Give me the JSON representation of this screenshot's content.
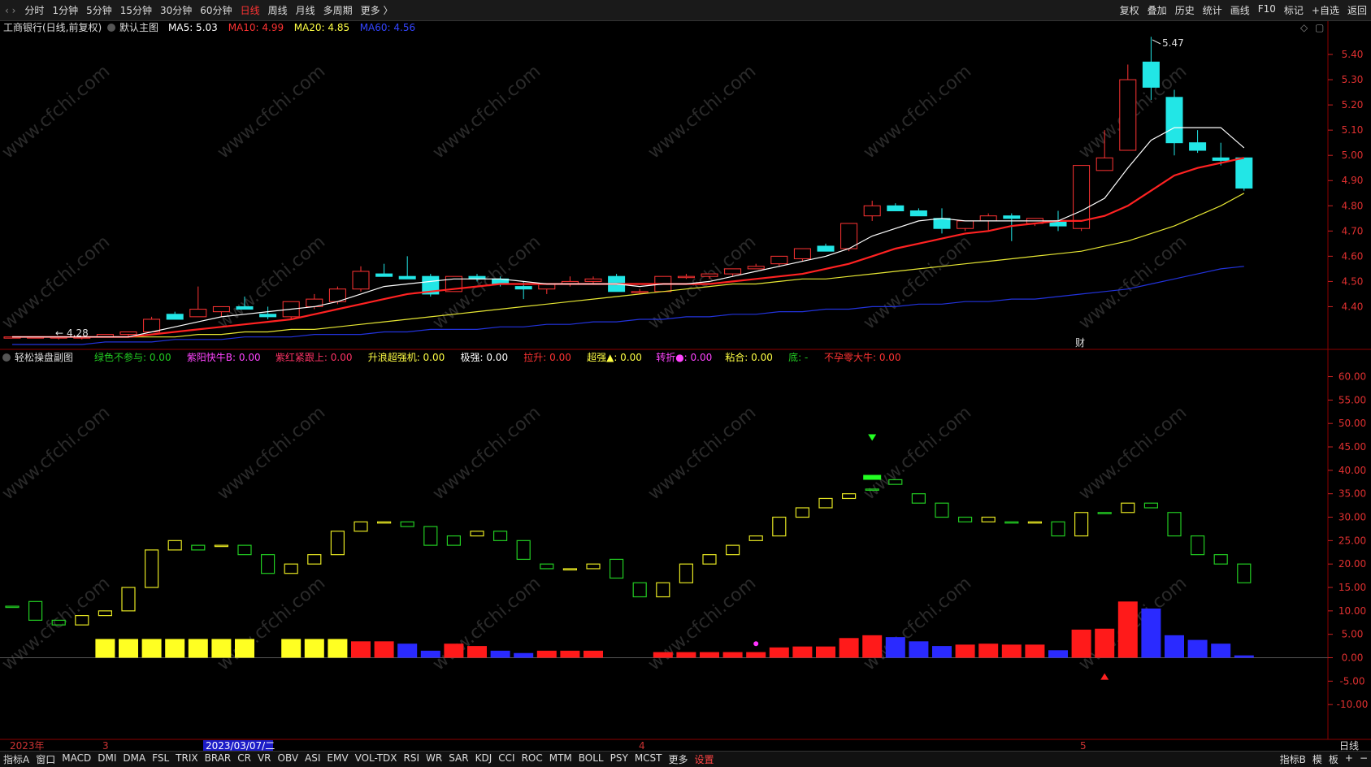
{
  "toolbar": {
    "periods": [
      "分时",
      "1分钟",
      "5分钟",
      "15分钟",
      "30分钟",
      "60分钟",
      "日线",
      "周线",
      "月线",
      "多周期",
      "更多 〉"
    ],
    "active_period": "日线",
    "right_tools": [
      "复权",
      "叠加",
      "历史",
      "统计",
      "画线",
      "F10",
      "标记",
      "+自选",
      "返回"
    ]
  },
  "main_panel": {
    "title": "工商银行(日线,前复权)",
    "chart_name": "默认主图",
    "ma_labels": [
      {
        "text": "MA5: 5.03",
        "color": "#ffffff"
      },
      {
        "text": "MA10: 4.99",
        "color": "#ff3333"
      },
      {
        "text": "MA20: 4.85",
        "color": "#ffff44"
      },
      {
        "text": "MA60: 4.56",
        "color": "#3344ff"
      }
    ],
    "price_ticks": [
      "5.40",
      "5.30",
      "5.20",
      "5.10",
      "5.00",
      "4.90",
      "4.80",
      "4.70",
      "4.60",
      "4.50",
      "4.40"
    ],
    "high_label": "5.47",
    "low_label": "4.28",
    "finance_marker": "财"
  },
  "sub_panel": {
    "title": "轻松操盘副图",
    "signals": [
      {
        "text": "绿色不参与: 0.00",
        "color": "#22cc22"
      },
      {
        "text": "紫阳快牛B: 0.00",
        "color": "#ff44ff"
      },
      {
        "text": "紫红紧跟上: 0.00",
        "color": "#ff3366"
      },
      {
        "text": "升浪超强机: 0.00",
        "color": "#ffff44"
      },
      {
        "text": "极强: 0.00",
        "color": "#ffffff"
      },
      {
        "text": "拉升: 0.00",
        "color": "#ff3333"
      },
      {
        "text": "超强▲: 0.00",
        "color": "#ffff44"
      },
      {
        "text": "转折●: 0.00",
        "color": "#ff44ff"
      },
      {
        "text": "粘合: 0.00",
        "color": "#ffff44"
      },
      {
        "text": "底: -",
        "color": "#22cc22"
      },
      {
        "text": "不孕零大牛: 0.00",
        "color": "#ff3333"
      }
    ],
    "value_ticks": [
      "60.00",
      "55.00",
      "50.00",
      "45.00",
      "40.00",
      "35.00",
      "30.00",
      "25.00",
      "20.00",
      "15.00",
      "10.00",
      "5.00",
      "0.00",
      "-5.00",
      "-10.00"
    ]
  },
  "date_axis": {
    "labels": [
      "2023年",
      "3",
      "2023/03/07/二",
      "4",
      "5"
    ],
    "period_label": "日线"
  },
  "bottom_tabs": {
    "left": [
      "指标A",
      "窗口",
      "MACD",
      "DMI",
      "DMA",
      "FSL",
      "TRIX",
      "BRAR",
      "CR",
      "VR",
      "OBV",
      "ASI",
      "EMV",
      "VOL-TDX",
      "RSI",
      "WR",
      "SAR",
      "KDJ",
      "CCI",
      "ROC",
      "MTM",
      "BOLL",
      "PSY",
      "MCST",
      "更多",
      "设置"
    ],
    "right": [
      "指标B",
      "模",
      "板",
      "+",
      "−"
    ]
  },
  "watermark": "www.cfchi.com",
  "chart_data": {
    "type": "candlestick",
    "price_range": [
      4.25,
      5.5
    ],
    "candles": [
      [
        4.28,
        4.28,
        4.28,
        4.28
      ],
      [
        4.28,
        4.28,
        4.28,
        4.28
      ],
      [
        4.28,
        4.28,
        4.27,
        4.28
      ],
      [
        4.28,
        4.28,
        4.27,
        4.28
      ],
      [
        4.28,
        4.29,
        4.28,
        4.29
      ],
      [
        4.29,
        4.3,
        4.28,
        4.3
      ],
      [
        4.3,
        4.36,
        4.3,
        4.35
      ],
      [
        4.37,
        4.38,
        4.35,
        4.35
      ],
      [
        4.36,
        4.48,
        4.36,
        4.39
      ],
      [
        4.38,
        4.4,
        4.36,
        4.4
      ],
      [
        4.4,
        4.44,
        4.39,
        4.39
      ],
      [
        4.37,
        4.4,
        4.35,
        4.36
      ],
      [
        4.36,
        4.42,
        4.35,
        4.42
      ],
      [
        4.4,
        4.45,
        4.39,
        4.43
      ],
      [
        4.42,
        4.48,
        4.41,
        4.47
      ],
      [
        4.47,
        4.56,
        4.46,
        4.54
      ],
      [
        4.53,
        4.57,
        4.52,
        4.52
      ],
      [
        4.52,
        4.6,
        4.51,
        4.51
      ],
      [
        4.52,
        4.53,
        4.44,
        4.45
      ],
      [
        4.46,
        4.52,
        4.46,
        4.52
      ],
      [
        4.52,
        4.53,
        4.5,
        4.51
      ],
      [
        4.51,
        4.52,
        4.48,
        4.49
      ],
      [
        4.48,
        4.5,
        4.43,
        4.47
      ],
      [
        4.47,
        4.49,
        4.45,
        4.49
      ],
      [
        4.49,
        4.52,
        4.48,
        4.5
      ],
      [
        4.5,
        4.52,
        4.49,
        4.51
      ],
      [
        4.52,
        4.53,
        4.46,
        4.46
      ],
      [
        4.46,
        4.47,
        4.45,
        4.46
      ],
      [
        4.46,
        4.52,
        4.46,
        4.52
      ],
      [
        4.52,
        4.53,
        4.51,
        4.52
      ],
      [
        4.52,
        4.53,
        4.51,
        4.53
      ],
      [
        4.53,
        4.55,
        4.52,
        4.55
      ],
      [
        4.55,
        4.57,
        4.55,
        4.56
      ],
      [
        4.57,
        4.6,
        4.56,
        4.6
      ],
      [
        4.59,
        4.63,
        4.58,
        4.63
      ],
      [
        4.64,
        4.65,
        4.62,
        4.62
      ],
      [
        4.63,
        4.73,
        4.62,
        4.73
      ],
      [
        4.76,
        4.82,
        4.74,
        4.8
      ],
      [
        4.8,
        4.81,
        4.78,
        4.78
      ],
      [
        4.78,
        4.79,
        4.76,
        4.76
      ],
      [
        4.75,
        4.79,
        4.69,
        4.71
      ],
      [
        4.71,
        4.74,
        4.7,
        4.74
      ],
      [
        4.74,
        4.77,
        4.7,
        4.76
      ],
      [
        4.76,
        4.77,
        4.66,
        4.75
      ],
      [
        4.73,
        4.75,
        4.72,
        4.75
      ],
      [
        4.74,
        4.78,
        4.7,
        4.72
      ],
      [
        4.71,
        4.96,
        4.7,
        4.96
      ],
      [
        4.94,
        5.1,
        4.94,
        4.99
      ],
      [
        5.02,
        5.36,
        5.02,
        5.3
      ],
      [
        5.37,
        5.47,
        5.22,
        5.27
      ],
      [
        5.23,
        5.26,
        5.0,
        5.05
      ],
      [
        5.05,
        5.1,
        5.01,
        5.02
      ],
      [
        4.99,
        5.05,
        4.96,
        4.98
      ],
      [
        4.99,
        4.99,
        4.86,
        4.87
      ]
    ],
    "ma5": [
      4.28,
      4.28,
      4.28,
      4.28,
      4.28,
      4.28,
      4.3,
      4.32,
      4.34,
      4.36,
      4.37,
      4.38,
      4.39,
      4.4,
      4.42,
      4.45,
      4.48,
      4.49,
      4.5,
      4.51,
      4.51,
      4.51,
      4.5,
      4.49,
      4.49,
      4.49,
      4.49,
      4.48,
      4.49,
      4.49,
      4.5,
      4.52,
      4.54,
      4.56,
      4.58,
      4.6,
      4.63,
      4.68,
      4.71,
      4.74,
      4.75,
      4.74,
      4.74,
      4.74,
      4.74,
      4.74,
      4.78,
      4.83,
      4.95,
      5.06,
      5.11,
      5.11,
      5.11,
      5.03
    ],
    "ma10": [
      4.28,
      4.28,
      4.28,
      4.28,
      4.28,
      4.28,
      4.29,
      4.3,
      4.31,
      4.32,
      4.33,
      4.34,
      4.35,
      4.37,
      4.39,
      4.41,
      4.43,
      4.45,
      4.46,
      4.47,
      4.48,
      4.49,
      4.49,
      4.49,
      4.49,
      4.49,
      4.49,
      4.49,
      4.49,
      4.49,
      4.49,
      4.5,
      4.51,
      4.52,
      4.53,
      4.55,
      4.57,
      4.6,
      4.63,
      4.65,
      4.67,
      4.69,
      4.7,
      4.72,
      4.73,
      4.74,
      4.74,
      4.76,
      4.8,
      4.86,
      4.92,
      4.95,
      4.97,
      4.99
    ],
    "ma20": [
      4.28,
      4.28,
      4.28,
      4.28,
      4.28,
      4.28,
      4.28,
      4.28,
      4.29,
      4.29,
      4.3,
      4.3,
      4.31,
      4.31,
      4.32,
      4.33,
      4.34,
      4.35,
      4.36,
      4.37,
      4.38,
      4.39,
      4.4,
      4.41,
      4.42,
      4.43,
      4.44,
      4.45,
      4.46,
      4.47,
      4.48,
      4.49,
      4.49,
      4.5,
      4.51,
      4.51,
      4.52,
      4.53,
      4.54,
      4.55,
      4.56,
      4.57,
      4.58,
      4.59,
      4.6,
      4.61,
      4.62,
      4.64,
      4.66,
      4.69,
      4.72,
      4.76,
      4.8,
      4.85
    ],
    "ma60": [
      4.25,
      4.25,
      4.25,
      4.25,
      4.26,
      4.26,
      4.26,
      4.27,
      4.27,
      4.27,
      4.28,
      4.28,
      4.28,
      4.29,
      4.29,
      4.29,
      4.3,
      4.3,
      4.31,
      4.31,
      4.31,
      4.32,
      4.32,
      4.33,
      4.33,
      4.34,
      4.34,
      4.35,
      4.35,
      4.36,
      4.36,
      4.37,
      4.37,
      4.38,
      4.38,
      4.39,
      4.39,
      4.4,
      4.4,
      4.41,
      4.41,
      4.42,
      4.42,
      4.43,
      4.43,
      4.44,
      4.45,
      4.46,
      4.47,
      4.49,
      4.51,
      4.53,
      4.55,
      4.56
    ],
    "sub_range": [
      -15,
      62
    ],
    "indicator_boxes": [
      [
        11,
        11,
        "g"
      ],
      [
        8,
        12,
        "g"
      ],
      [
        7,
        8,
        "g"
      ],
      [
        7,
        9,
        "y"
      ],
      [
        9,
        10,
        "y"
      ],
      [
        10,
        15,
        "y"
      ],
      [
        15,
        23,
        "y"
      ],
      [
        23,
        25,
        "y"
      ],
      [
        24,
        23,
        "g"
      ],
      [
        24,
        24,
        "y"
      ],
      [
        24,
        22,
        "g"
      ],
      [
        22,
        18,
        "g"
      ],
      [
        18,
        20,
        "y"
      ],
      [
        20,
        22,
        "y"
      ],
      [
        22,
        27,
        "y"
      ],
      [
        27,
        29,
        "y"
      ],
      [
        29,
        29,
        "y"
      ],
      [
        29,
        28,
        "g"
      ],
      [
        28,
        24,
        "g"
      ],
      [
        26,
        24,
        "g"
      ],
      [
        26,
        27,
        "y"
      ],
      [
        27,
        25,
        "g"
      ],
      [
        25,
        21,
        "g"
      ],
      [
        20,
        19,
        "g"
      ],
      [
        19,
        19,
        "y"
      ],
      [
        19,
        20,
        "y"
      ],
      [
        21,
        17,
        "g"
      ],
      [
        16,
        13,
        "g"
      ],
      [
        13,
        16,
        "y"
      ],
      [
        16,
        20,
        "y"
      ],
      [
        20,
        22,
        "y"
      ],
      [
        22,
        24,
        "y"
      ],
      [
        25,
        26,
        "y"
      ],
      [
        26,
        30,
        "y"
      ],
      [
        30,
        32,
        "y"
      ],
      [
        32,
        34,
        "y"
      ],
      [
        34,
        35,
        "y"
      ],
      [
        36,
        36,
        "g"
      ],
      [
        37,
        38,
        "g"
      ],
      [
        35,
        33,
        "g"
      ],
      [
        33,
        30,
        "g"
      ],
      [
        30,
        29,
        "g"
      ],
      [
        30,
        29,
        "y"
      ],
      [
        29,
        29,
        "g"
      ],
      [
        29,
        29,
        "y"
      ],
      [
        29,
        26,
        "g"
      ],
      [
        26,
        31,
        "y"
      ],
      [
        31,
        31,
        "g"
      ],
      [
        31,
        33,
        "y"
      ],
      [
        33,
        32,
        "g"
      ],
      [
        31,
        26,
        "g"
      ],
      [
        26,
        22,
        "g"
      ],
      [
        22,
        20,
        "g"
      ],
      [
        20,
        16,
        "g"
      ]
    ],
    "histogram": [
      [
        0,
        "n"
      ],
      [
        0,
        "n"
      ],
      [
        0,
        "n"
      ],
      [
        4,
        "y"
      ],
      [
        4,
        "y"
      ],
      [
        4,
        "y"
      ],
      [
        4,
        "y"
      ],
      [
        4,
        "y"
      ],
      [
        4,
        "y"
      ],
      [
        4,
        "y"
      ],
      [
        0,
        "n"
      ],
      [
        4,
        "y"
      ],
      [
        4,
        "y"
      ],
      [
        4,
        "y"
      ],
      [
        3.5,
        "r"
      ],
      [
        3.5,
        "r"
      ],
      [
        3,
        "b"
      ],
      [
        1.5,
        "b"
      ],
      [
        3,
        "r"
      ],
      [
        2.5,
        "r"
      ],
      [
        1.5,
        "b"
      ],
      [
        1,
        "b"
      ],
      [
        1.5,
        "r"
      ],
      [
        1.5,
        "r"
      ],
      [
        1.5,
        "r"
      ],
      [
        0,
        "n"
      ],
      [
        0,
        "n"
      ],
      [
        1.2,
        "r"
      ],
      [
        1.2,
        "r"
      ],
      [
        1.2,
        "r"
      ],
      [
        1.2,
        "r"
      ],
      [
        1.2,
        "r"
      ],
      [
        2.2,
        "r"
      ],
      [
        2.4,
        "r"
      ],
      [
        2.4,
        "r"
      ],
      [
        4.2,
        "r"
      ],
      [
        4.8,
        "r"
      ],
      [
        4.4,
        "b"
      ],
      [
        3.5,
        "b"
      ],
      [
        2.5,
        "b"
      ],
      [
        2.8,
        "r"
      ],
      [
        3,
        "r"
      ],
      [
        2.8,
        "r"
      ],
      [
        2.8,
        "r"
      ],
      [
        1.6,
        "b"
      ],
      [
        6,
        "r"
      ],
      [
        6.2,
        "r"
      ],
      [
        12,
        "r"
      ],
      [
        10.5,
        "b"
      ],
      [
        4.8,
        "b"
      ],
      [
        3.8,
        "b"
      ],
      [
        3,
        "b"
      ],
      [
        0.5,
        "b"
      ]
    ],
    "signals": [
      {
        "index": 37,
        "kind": "down-arrow",
        "value": 47
      },
      {
        "index": 37,
        "kind": "bar-marker",
        "value": 38.5
      },
      {
        "index": 32,
        "kind": "dot",
        "value": 3
      },
      {
        "index": 47,
        "kind": "up-arrow",
        "value": -4
      }
    ]
  }
}
